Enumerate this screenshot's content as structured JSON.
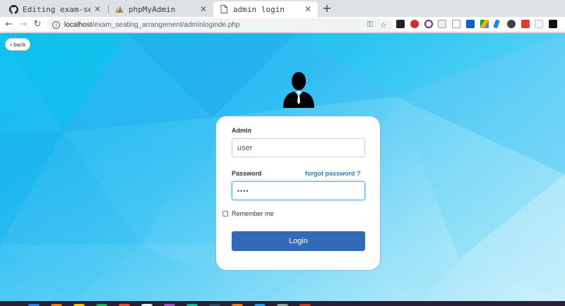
{
  "browser": {
    "tabs": [
      {
        "title": "Editing exam-seatin",
        "icon": "github-icon",
        "active": false
      },
      {
        "title": "phpMyAdmin",
        "icon": "phpmyadmin-icon",
        "active": false
      },
      {
        "title": "admin login",
        "icon": "page-icon",
        "active": true
      }
    ],
    "new_tab_label": "+",
    "close_glyph": "✕",
    "url_host": "localhost",
    "url_path": "/exam_seating_arrangement/adminloginde.php"
  },
  "page": {
    "back_label": "back",
    "form": {
      "admin_label": "Admin",
      "admin_value": "user",
      "password_label": "Password",
      "password_value": "••••",
      "forgot_label": "forgot password ?",
      "remember_label": "Remember me",
      "login_label": "Login"
    }
  },
  "colors": {
    "accent": "#3269b8",
    "link": "#337ab7",
    "background": "#1ab6f0"
  }
}
